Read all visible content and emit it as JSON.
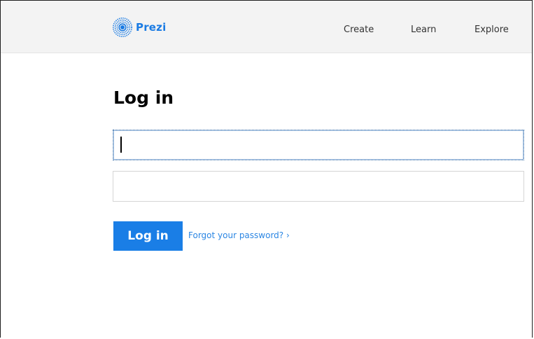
{
  "header": {
    "logo_text": "Prezi",
    "nav": {
      "create": "Create",
      "learn": "Learn",
      "explore": "Explore"
    }
  },
  "login": {
    "title": "Log in",
    "email": {
      "value": "",
      "placeholder": ""
    },
    "password": {
      "value": "",
      "placeholder": ""
    },
    "submit_label": "Log in",
    "forgot_label": "Forgot your password? ›"
  },
  "colors": {
    "brand_blue": "#1a7ee6",
    "link_blue": "#2b86e3",
    "header_bg": "#f3f3f3"
  },
  "icons": {
    "logo": "prezi-logo-icon"
  }
}
